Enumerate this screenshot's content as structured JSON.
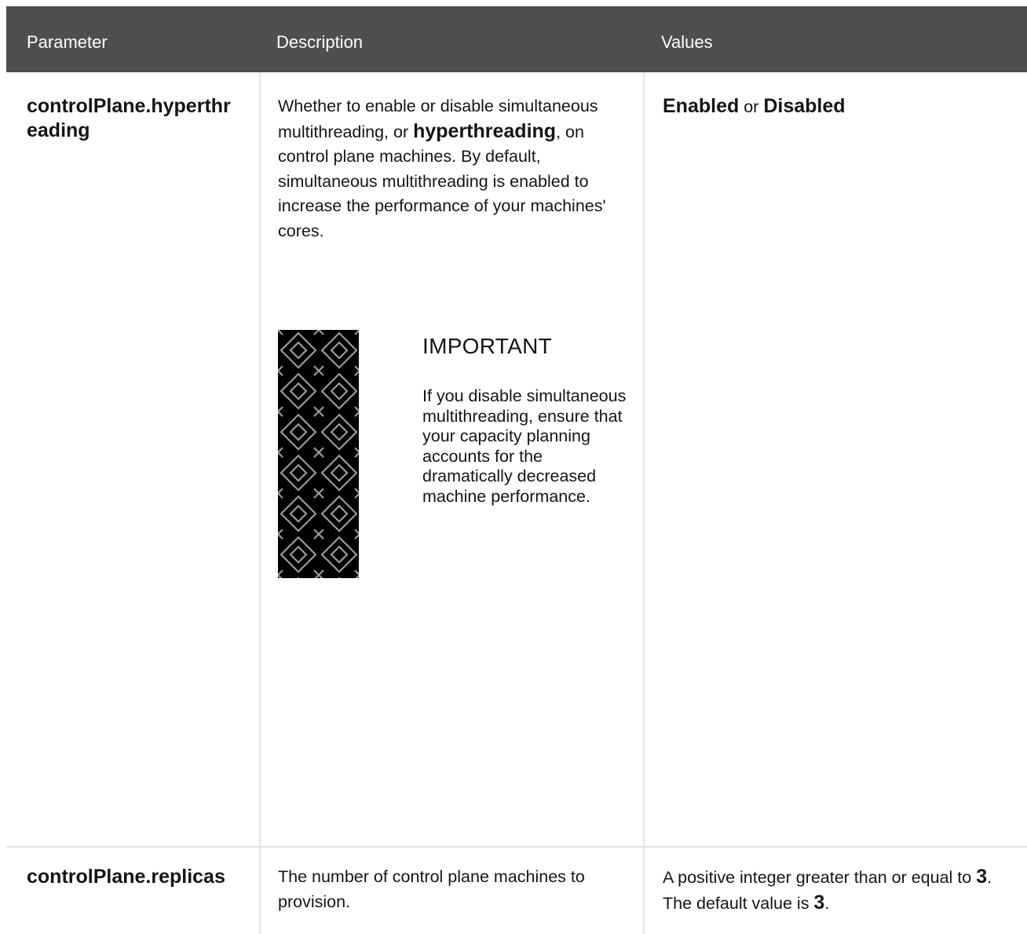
{
  "table": {
    "headers": {
      "parameter": "Parameter",
      "description": "Description",
      "values": "Values"
    },
    "rows": [
      {
        "parameter": "controlPlane.hyperthreading",
        "description": {
          "before": "Whether to enable or disable simultaneous multithreading, or ",
          "strong": "hyperthreading",
          "after": ", on control plane machines. By default, simultaneous multithreading is enabled to increase the performance of your machines' cores."
        },
        "admonition": {
          "icon": "important-pattern-icon",
          "title": "IMPORTANT",
          "body": "If you disable simultaneous multithreading, ensure that your capacity planning accounts for the dramatically decreased machine performance."
        },
        "values": {
          "option_a": "Enabled",
          "separator": " or ",
          "option_b": "Disabled"
        }
      },
      {
        "parameter": "controlPlane.replicas",
        "description": "The number of control plane machines to provision.",
        "values": {
          "before": "A positive integer greater than or equal to ",
          "min": "3",
          "middle": ". The default value is ",
          "default": "3",
          "after": "."
        }
      }
    ]
  },
  "colors": {
    "header_bg": "#4f4f4f",
    "header_text": "#ffffff",
    "grid_line": "#e4e4e4",
    "text": "#151515",
    "admonition_icon_bg": "#000000"
  }
}
